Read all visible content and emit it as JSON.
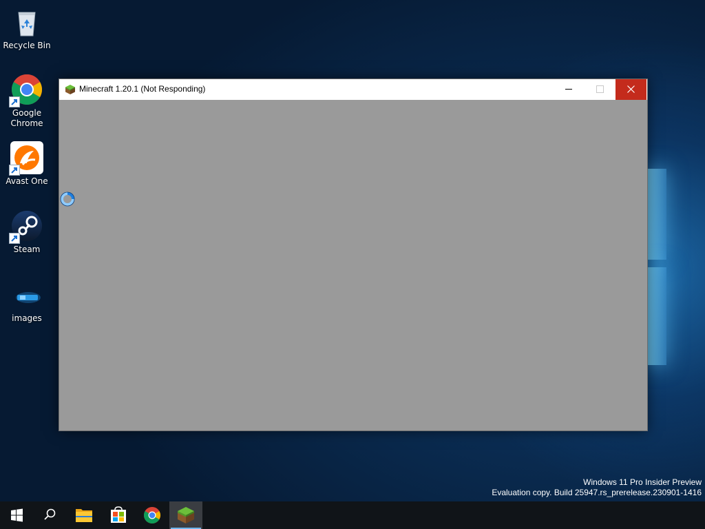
{
  "desktop": {
    "icons": [
      {
        "label": "Recycle Bin",
        "icon": "recycle-bin-icon"
      },
      {
        "label": "Google\nChrome",
        "icon": "chrome-icon"
      },
      {
        "label": "Avast One",
        "icon": "avast-icon"
      },
      {
        "label": "Steam",
        "icon": "steam-icon"
      },
      {
        "label": "images",
        "icon": "folder-images-icon"
      }
    ]
  },
  "window": {
    "title": "Minecraft 1.20.1 (Not Responding)",
    "icon": "minecraft-grass-block-icon",
    "controls": [
      "minimize",
      "maximize",
      "close"
    ]
  },
  "watermark": {
    "line1": "Windows 11 Pro Insider Preview",
    "line2": "Evaluation copy. Build 25947.rs_prerelease.230901-1416"
  },
  "taskbar": {
    "items": [
      {
        "name": "start",
        "icon": "windows-start-icon"
      },
      {
        "name": "search",
        "icon": "search-icon"
      },
      {
        "name": "file-explorer",
        "icon": "folder-icon"
      },
      {
        "name": "microsoft-store",
        "icon": "store-icon"
      },
      {
        "name": "chrome",
        "icon": "chrome-icon"
      },
      {
        "name": "minecraft",
        "icon": "minecraft-grass-block-icon",
        "active": true
      }
    ]
  },
  "colors": {
    "close_button": "#c42b1c",
    "window_client": "#9a9a9a",
    "taskbar": "#101418",
    "busy_cursor": "#1e90ff"
  }
}
